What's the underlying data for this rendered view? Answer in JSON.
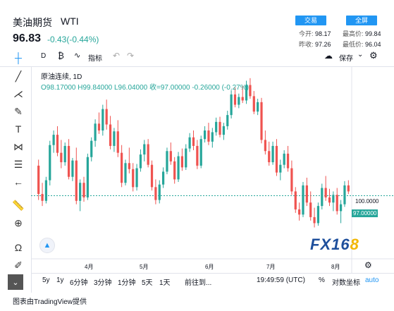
{
  "header": {
    "title": "美油期货",
    "symbol": "WTI",
    "price": "96.83",
    "change": "-0.43(-0.44%)",
    "btn_trade": "交易",
    "btn_fullscreen": "全屏",
    "stats": {
      "open_label": "今开:",
      "open": "98.17",
      "high_label": "最高价:",
      "high": "99.84",
      "prev_label": "昨收:",
      "prev": "97.26",
      "low_label": "最低价:",
      "low": "96.04"
    }
  },
  "toolbar": {
    "interval": "D",
    "indicators": "指标",
    "save": "保存"
  },
  "legend": {
    "line1": "原油连续, 1D",
    "line2": "O98.17000  H99.84000  L96.04000  收=97.00000  -0.26000 (-0.27%)"
  },
  "chart_data": {
    "type": "candlestick",
    "x_ticks": [
      "4月",
      "5月",
      "6月",
      "7月",
      "8月"
    ],
    "price_labels": [
      "100.0000",
      "97.00000"
    ],
    "last_price": 97.0,
    "ylim": [
      88,
      112
    ],
    "ohlc": [
      [
        100.5,
        101.2,
        96.5,
        97.2
      ],
      [
        97.2,
        98.5,
        95.8,
        96.4
      ],
      [
        96.4,
        99.2,
        96.1,
        98.8
      ],
      [
        98.8,
        103.4,
        98.2,
        102.9
      ],
      [
        102.9,
        104.6,
        102,
        104.1
      ],
      [
        104.1,
        105.1,
        101.6,
        102
      ],
      [
        102,
        103.5,
        100.2,
        100.9
      ],
      [
        100.9,
        103.2,
        100.5,
        102.8
      ],
      [
        102.8,
        103.6,
        98.9,
        99.2
      ],
      [
        99.2,
        101.4,
        98.7,
        101.1
      ],
      [
        101.1,
        102.6,
        96,
        96.4
      ],
      [
        96.4,
        98.9,
        95.2,
        98.5
      ],
      [
        98.5,
        99.2,
        96.3,
        96.8
      ],
      [
        96.8,
        101.9,
        96.5,
        101.5
      ],
      [
        101.5,
        103.8,
        101,
        103.4
      ],
      [
        103.4,
        105.9,
        102.7,
        105.4
      ],
      [
        105.4,
        106.7,
        104.2,
        104.6
      ],
      [
        104.6,
        107.6,
        104,
        107.1
      ],
      [
        107.1,
        108.2,
        104.7,
        105.3
      ],
      [
        105.3,
        106.3,
        102.4,
        102.8
      ],
      [
        102.8,
        104.9,
        102.1,
        104.5
      ],
      [
        104.5,
        105.8,
        101.5,
        102
      ],
      [
        102,
        102.9,
        98,
        98.5
      ],
      [
        98.5,
        101.2,
        98.2,
        100.8
      ],
      [
        100.8,
        102.6,
        99.6,
        100.1
      ],
      [
        100.1,
        100.8,
        97.5,
        98
      ],
      [
        98,
        100.7,
        97.6,
        100.2
      ],
      [
        100.2,
        102.4,
        99.8,
        101.8
      ],
      [
        101.8,
        103.5,
        101,
        103
      ],
      [
        103,
        103.6,
        100.3,
        100.6
      ],
      [
        100.6,
        101.1,
        97.6,
        98
      ],
      [
        98,
        98.9,
        96,
        96.5
      ],
      [
        96.5,
        98.8,
        96.1,
        98.3
      ],
      [
        98.3,
        100.3,
        97.9,
        99.8
      ],
      [
        99.8,
        102.6,
        99.5,
        102.2
      ],
      [
        102.2,
        103.2,
        100.6,
        101
      ],
      [
        101,
        101.5,
        98.4,
        98.9
      ],
      [
        98.9,
        102.1,
        98.6,
        101.6
      ],
      [
        101.6,
        102.5,
        99.9,
        100.3
      ],
      [
        100.3,
        103,
        100,
        102.5
      ],
      [
        102.5,
        104.3,
        102.1,
        103.8
      ],
      [
        103.8,
        104.6,
        102.3,
        102.8
      ],
      [
        102.8,
        103.5,
        100.1,
        100.5
      ],
      [
        100.5,
        104,
        100.2,
        103.6
      ],
      [
        103.6,
        105.1,
        103.2,
        104.6
      ],
      [
        104.6,
        105.5,
        102.9,
        103.3
      ],
      [
        103.3,
        104.9,
        102.6,
        104.4
      ],
      [
        104.4,
        106.1,
        104,
        105.6
      ],
      [
        105.6,
        106.2,
        103.8,
        104.1
      ],
      [
        104.1,
        105.5,
        103.5,
        105.1
      ],
      [
        105.1,
        106.9,
        104.7,
        106.4
      ],
      [
        106.4,
        109.3,
        106,
        108.8
      ],
      [
        108.8,
        109.6,
        107.3,
        107.6
      ],
      [
        107.6,
        108.9,
        107.2,
        108.5
      ],
      [
        108.5,
        109.8,
        107.8,
        108.1
      ],
      [
        108.1,
        110.4,
        107.7,
        109.9
      ],
      [
        109.9,
        110.7,
        108.3,
        108.6
      ],
      [
        108.6,
        109.2,
        106.5,
        106.8
      ],
      [
        106.8,
        108.3,
        106.4,
        107.9
      ],
      [
        107.9,
        108.4,
        103.1,
        103.5
      ],
      [
        103.5,
        104.6,
        101.8,
        102.2
      ],
      [
        102.2,
        103.3,
        100.5,
        100.9
      ],
      [
        100.9,
        103.3,
        100.6,
        102.8
      ],
      [
        102.8,
        103.6,
        99.3,
        99.7
      ],
      [
        99.7,
        101.2,
        98.8,
        100.6
      ],
      [
        100.6,
        102.3,
        100.2,
        101.9
      ],
      [
        101.9,
        102.8,
        99.8,
        100.2
      ],
      [
        100.2,
        101.1,
        97.1,
        97.5
      ],
      [
        97.5,
        98,
        95,
        95.4
      ],
      [
        95.4,
        96.2,
        94.1,
        94.8
      ],
      [
        94.8,
        98.6,
        94.5,
        98.2
      ],
      [
        98.2,
        99.1,
        95.8,
        96.2
      ],
      [
        96.2,
        97.5,
        94.1,
        94.5
      ],
      [
        94.5,
        95.6,
        93.3,
        93.8
      ],
      [
        93.8,
        96.2,
        93.5,
        95.8
      ],
      [
        95.8,
        98.4,
        95.4,
        97.9
      ],
      [
        97.9,
        99.3,
        96.4,
        96.8
      ],
      [
        96.8,
        97.8,
        95.8,
        96.2
      ],
      [
        96.2,
        97.5,
        95.2,
        97.1
      ],
      [
        97.1,
        97.9,
        94.8,
        95.2
      ],
      [
        95.2,
        96.5,
        93.8,
        96
      ],
      [
        96,
        98.7,
        95.7,
        98.2
      ],
      [
        98.2,
        98.8,
        97.2,
        97.5
      ]
    ]
  },
  "bottom": {
    "ranges": [
      "5y",
      "1y",
      "6分钟",
      "3分钟",
      "1分钟",
      "5天",
      "1天"
    ],
    "goto": "前往到...",
    "time": "19:49:59 (UTC)",
    "percent": "%",
    "log": "对数坐标",
    "auto": "auto"
  },
  "credit": "图表由TradingView提供",
  "watermark": {
    "text": "FX16",
    "accent": "8"
  },
  "colors": {
    "up": "#26a69a",
    "down": "#ef5350",
    "accent": "#2196f3"
  }
}
